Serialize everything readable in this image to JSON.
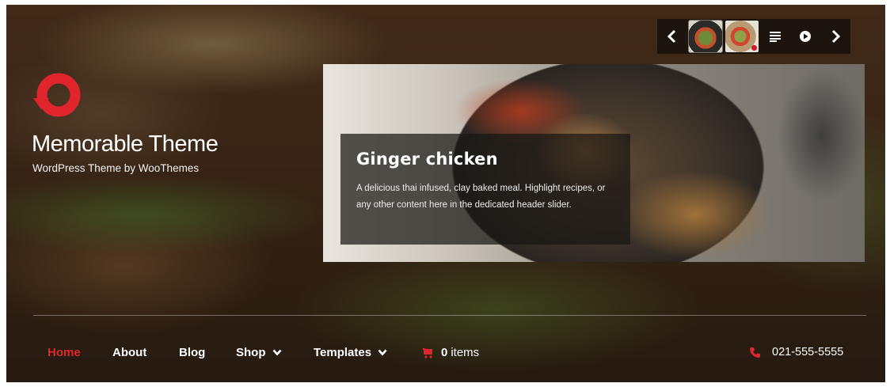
{
  "site": {
    "title": "Memorable Theme",
    "tagline": "WordPress Theme by WooThemes",
    "brand_color": "#e0262c"
  },
  "slider": {
    "prev_icon": "chevron-left-icon",
    "next_icon": "chevron-right-icon",
    "text_icon": "text-lines-icon",
    "play_icon": "play-icon",
    "slide": {
      "title": "Ginger chicken",
      "text": "A delicious thai infused, clay baked meal. Highlight recipes, or any other content here in the dedicated header slider."
    }
  },
  "nav": {
    "items": [
      {
        "label": "Home",
        "active": true
      },
      {
        "label": "About",
        "active": false
      },
      {
        "label": "Blog",
        "active": false
      },
      {
        "label": "Shop",
        "dropdown": true
      },
      {
        "label": "Templates",
        "dropdown": true
      }
    ],
    "cart": {
      "count": "0",
      "label": "items",
      "icon": "cart-icon"
    },
    "phone": {
      "number": "021-555-5555",
      "icon": "phone-icon"
    }
  }
}
